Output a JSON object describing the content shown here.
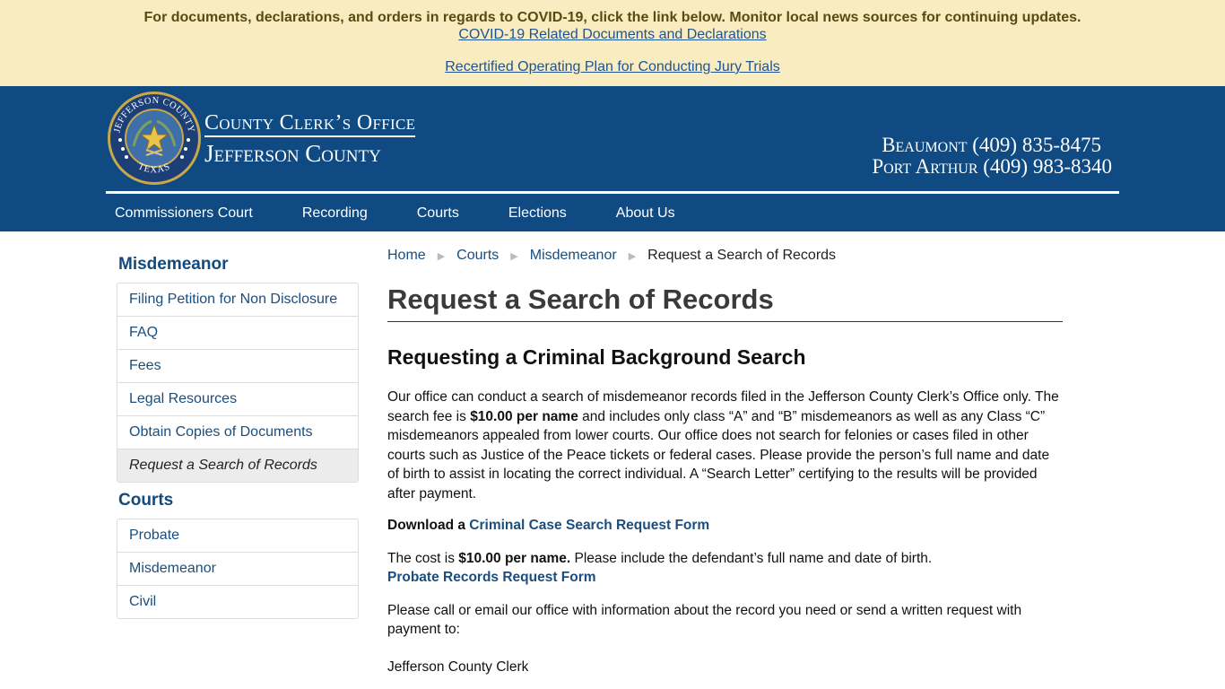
{
  "alert": {
    "message": "For documents, declarations, and orders in regards to COVID-19, click the link below. Monitor local news sources for continuing updates.",
    "link1": "COVID-19 Related Documents and Declarations",
    "link2": "Recertified Operating Plan for Conducting Jury Trials"
  },
  "header": {
    "seal_top_text": "JEFFERSON COUNTY",
    "seal_bottom_text": "TEXAS",
    "brand_line1": "County Clerk’s Office",
    "brand_line2": "Jefferson County",
    "phone1": "Beaumont (409) 835-8475",
    "phone2": "Port Arthur (409) 983-8340"
  },
  "nav": {
    "items": [
      "Commissioners Court",
      "Recording",
      "Courts",
      "Elections",
      "About Us"
    ]
  },
  "sidebar": {
    "section1_title": "Misdemeanor",
    "section1_items": [
      "Filing Petition for Non Disclosure",
      "FAQ",
      "Fees",
      "Legal Resources",
      "Obtain Copies of Documents",
      "Request a Search of Records"
    ],
    "section2_title": "Courts",
    "section2_items": [
      "Probate",
      "Misdemeanor",
      "Civil"
    ]
  },
  "breadcrumb": {
    "items": [
      "Home",
      "Courts",
      "Misdemeanor"
    ],
    "current": "Request a Search of Records"
  },
  "main": {
    "title": "Request a Search of Records",
    "subtitle": "Requesting a Criminal Background Search",
    "para1_a": "Our office can conduct a search of misdemeanor records filed in the Jefferson County Clerk’s Office only. The search fee is ",
    "para1_bold": "$10.00 per name",
    "para1_b": " and includes only class “A” and “B” misdemeanors as well as any Class “C” misdemeanors appealed from lower courts. Our office does not search for felonies or cases filed in other courts such as Justice of the Peace tickets or federal cases. Please provide the person’s full name and date of birth to assist in locating the correct individual. A “Search Letter” certifying to the results will be provided after payment.",
    "download_prefix": "Download a ",
    "download_link": "Criminal Case Search Request Form",
    "cost_a": "The cost is ",
    "cost_bold": "$10.00 per name.",
    "cost_b": " Please include the defendant’s full name and date of birth.",
    "probate_link": "Probate Records Request Form",
    "para3": "Please call or email our office with information about the record you need or send a written request with payment to:",
    "address1": "Jefferson County Clerk"
  }
}
